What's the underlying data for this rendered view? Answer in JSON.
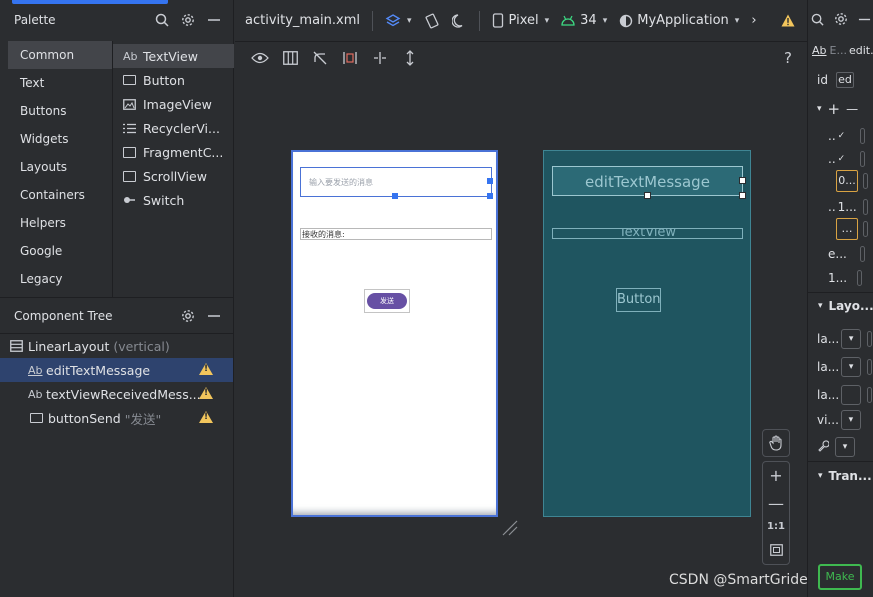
{
  "palette": {
    "title": "Palette",
    "categories": [
      "Common",
      "Text",
      "Buttons",
      "Widgets",
      "Layouts",
      "Containers",
      "Helpers",
      "Google",
      "Legacy"
    ],
    "items": [
      {
        "icon": "Ab",
        "label": "TextView"
      },
      {
        "icon": "button-icon",
        "label": "Button"
      },
      {
        "icon": "imageview-icon",
        "label": "ImageView"
      },
      {
        "icon": "list-icon",
        "label": "RecyclerVi..."
      },
      {
        "icon": "fragment-icon",
        "label": "FragmentC..."
      },
      {
        "icon": "scrollview-icon",
        "label": "ScrollView"
      },
      {
        "icon": "switch-icon",
        "label": "Switch"
      }
    ]
  },
  "tree": {
    "title": "Component Tree",
    "nodes": [
      {
        "label": "LinearLayout",
        "extra": "(vertical)"
      },
      {
        "label": "editTextMessage",
        "extra": ""
      },
      {
        "label": "textViewReceivedMess...",
        "extra": ""
      },
      {
        "label": "buttonSend",
        "extra": "\"发送\""
      }
    ]
  },
  "toolbar": {
    "file": "activity_main.xml",
    "device": "Pixel",
    "api": "34",
    "theme": "MyApplication"
  },
  "toolbar2": {
    "help": "?"
  },
  "design": {
    "edit_hint": "输入要发送的消息",
    "textview_text": "接收的消息:",
    "button_text": "发送"
  },
  "blueprint": {
    "edit_label": "editTextMessage",
    "textview_label": "TextView",
    "button_label": "Button"
  },
  "zoom": {
    "plus": "+",
    "minus": "—",
    "one_to_one": "1:1"
  },
  "attributes": {
    "header": "E...",
    "header_full": "edit...",
    "id_label": "id",
    "id_value": "ed",
    "rows": [
      "..",
      "..",
      "..",
      "..",
      "..",
      "e...",
      "1..."
    ],
    "mini_values": [
      "0...",
      "1..."
    ],
    "layout_section": "Layo...",
    "layout_rows": [
      "la...",
      "la...",
      "la...",
      "vi..."
    ],
    "transforms_section": "Tran..."
  },
  "watermark": "CSDN @SmartGridequation",
  "finish_label": "Make"
}
